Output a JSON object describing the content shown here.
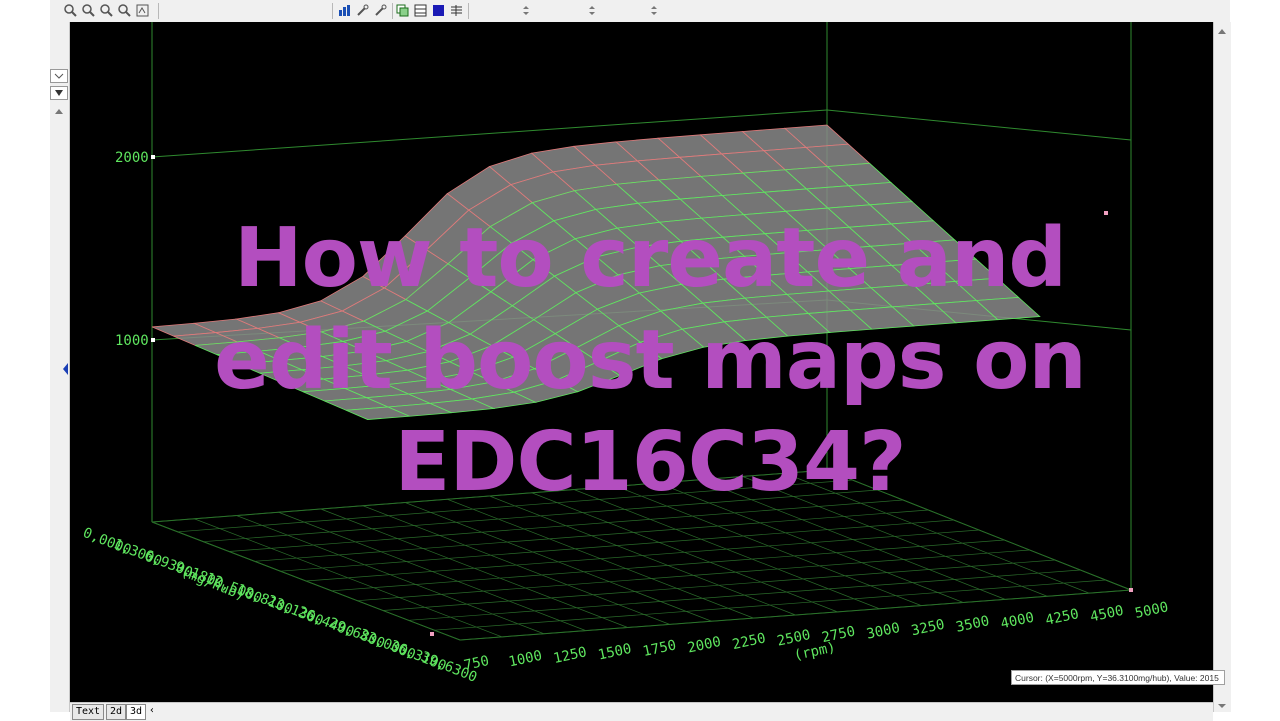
{
  "title_overlay": {
    "line1": "How to create and",
    "line2": "edit boost maps on",
    "line3": "EDC16C34?"
  },
  "graph": {
    "z_ticks": [
      "2000",
      "1000"
    ],
    "x_ticks": [
      "750",
      "1000",
      "1250",
      "1500",
      "1750",
      "2000",
      "2250",
      "2500",
      "2750",
      "3000",
      "3250",
      "3500",
      "4000",
      "4250",
      "4500",
      "5000"
    ],
    "x_axis_label": "(rpm)",
    "y_ticks": [
      "0,0000",
      "1,3000",
      "6,9300",
      "9,1800",
      "12,5000",
      "18,8100",
      "23,1300",
      "26,4400",
      "29,6800",
      "33,0000",
      "36,3100",
      "39,6300"
    ],
    "y_axis_label": "(mg/hub)",
    "colors": {
      "background": "#000000",
      "grid": "#5fe65f",
      "surface": "#8a8a8a",
      "surface_top": "#e07a7a"
    }
  },
  "tabs": [
    "Text",
    "2d",
    "3d"
  ],
  "tabs_nav": "‹",
  "cursor_readout": "Cursor: (X=5000rpm, Y=36.3100mg/hub), Value: 2015"
}
